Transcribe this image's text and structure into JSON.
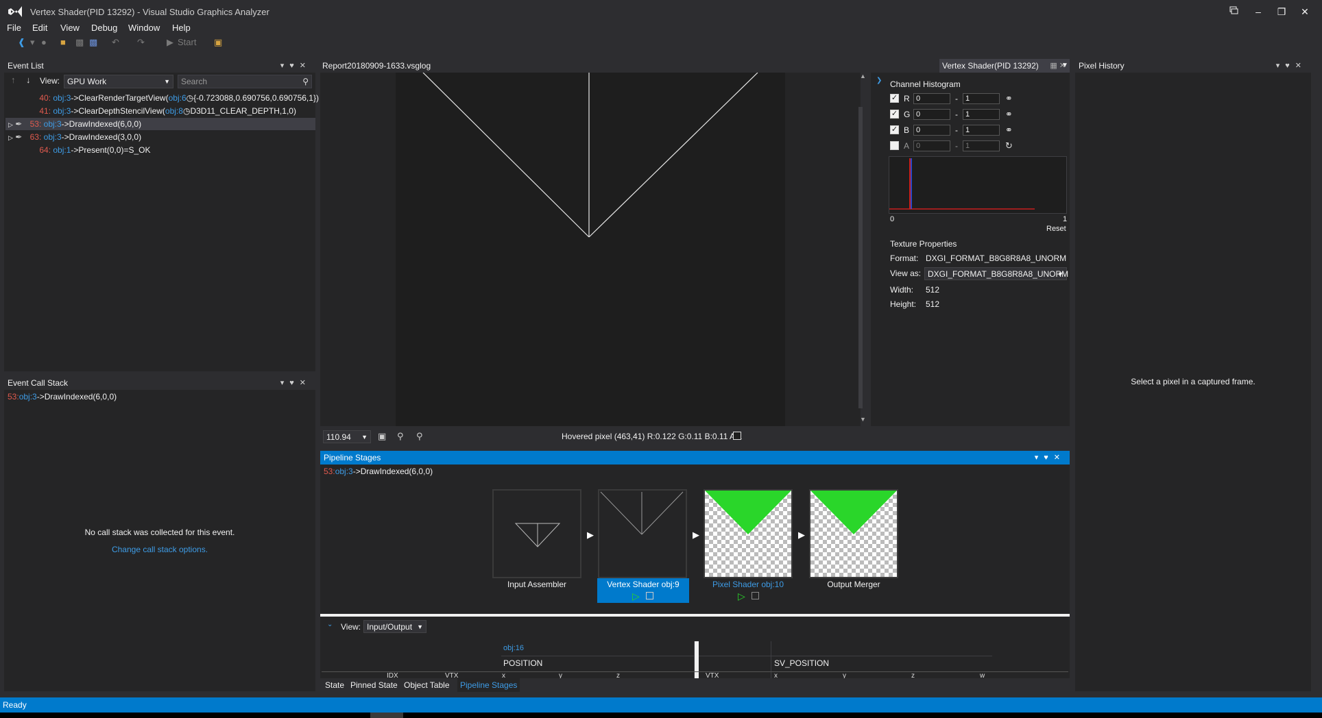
{
  "window": {
    "title": "Vertex Shader(PID 13292) - Visual Studio Graphics Analyzer"
  },
  "menu": [
    "File",
    "Edit",
    "View",
    "Debug",
    "Window",
    "Help"
  ],
  "toolbar": {
    "start_label": "Start"
  },
  "event_list": {
    "title": "Event List",
    "view_label": "View:",
    "view_value": "GPU Work",
    "search_placeholder": "Search",
    "rows": [
      {
        "id": "40:",
        "obj": "obj:3",
        "call": "->ClearRenderTargetView(",
        "arg_obj": "obj:6",
        "rest": "{-0.723088,0.690756,0.690756,1})"
      },
      {
        "id": "41:",
        "obj": "obj:3",
        "call": "->ClearDepthStencilView(",
        "arg_obj": "obj:8",
        "rest": "D3D11_CLEAR_DEPTH,1,0)"
      },
      {
        "id": "53:",
        "obj": "obj:3",
        "call": "->DrawIndexed(6,0,0)",
        "arg_obj": "",
        "rest": ""
      },
      {
        "id": "63:",
        "obj": "obj:3",
        "call": "->DrawIndexed(3,0,0)",
        "arg_obj": "",
        "rest": ""
      },
      {
        "id": "64:",
        "obj": "obj:1",
        "call": "->Present(0,0)=S_OK",
        "arg_obj": "",
        "rest": ""
      }
    ]
  },
  "call_stack": {
    "title": "Event Call Stack",
    "id": "53:",
    "obj": "obj:3",
    "call": "->DrawIndexed(6,0,0)",
    "message": "No call stack was collected for this event.",
    "link": "Change call stack options."
  },
  "document_tab": {
    "label": "Report20180909-1633.vsglog"
  },
  "vs_tab": {
    "label": "Vertex Shader(PID 13292)"
  },
  "image_status": {
    "zoom": "110.94",
    "hovered": "Hovered pixel (463,41) R:0.122 G:0.11 B:0.11 A:1"
  },
  "histogram": {
    "title": "Channel Histogram",
    "channels": [
      {
        "name": "R",
        "min": "0",
        "max": "1",
        "checked": true
      },
      {
        "name": "G",
        "min": "0",
        "max": "1",
        "checked": true
      },
      {
        "name": "B",
        "min": "0",
        "max": "1",
        "checked": true
      },
      {
        "name": "A",
        "min": "0",
        "max": "1",
        "checked": false
      }
    ],
    "range_sep": "-",
    "axis_min": "0",
    "axis_max": "1",
    "reset": "Reset"
  },
  "texture": {
    "title": "Texture Properties",
    "format_label": "Format:",
    "format": "DXGI_FORMAT_B8G8R8A8_UNORM",
    "viewas_label": "View as:",
    "viewas": "DXGI_FORMAT_B8G8R8A8_UNORM",
    "width_label": "Width:",
    "width": "512",
    "height_label": "Height:",
    "height": "512"
  },
  "pixel_history": {
    "title": "Pixel History",
    "message": "Select a pixel in a captured frame."
  },
  "pipeline": {
    "title": "Pipeline Stages",
    "event_id": "53:",
    "event_obj": "obj:3",
    "event_call": "->DrawIndexed(6,0,0)",
    "stages": [
      {
        "label": "Input Assembler"
      },
      {
        "label": "Vertex Shader obj:9"
      },
      {
        "label": "Pixel Shader obj:10"
      },
      {
        "label": "Output Merger"
      }
    ],
    "view_label": "View:",
    "view_value": "Input/Output",
    "table": {
      "obj": "obj:16",
      "left_header": "POSITION",
      "right_header": "SV_POSITION",
      "cols_left": [
        "IDX",
        "VTX",
        "x",
        "y",
        "z"
      ],
      "cols_right": [
        "VTX",
        "x",
        "y",
        "z",
        "w"
      ]
    }
  },
  "bottom_tabs": [
    "State",
    "Pinned State",
    "Object Table",
    "Pipeline Stages"
  ],
  "status": {
    "text": "Ready"
  },
  "colors": {
    "accent": "#007acc",
    "green": "#2ad62a",
    "link": "#3e9ce6",
    "id_red": "#e05a4e"
  }
}
